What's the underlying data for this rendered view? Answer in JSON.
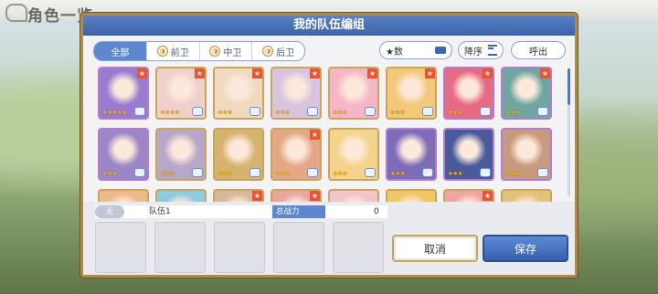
{
  "background": {
    "title": "角色一览"
  },
  "modal": {
    "title": "我的队伍编组"
  },
  "tabs": [
    {
      "label": "全部",
      "icon": ""
    },
    {
      "label": "前卫",
      "icon": "position-icon"
    },
    {
      "label": "中卫",
      "icon": "position-icon"
    },
    {
      "label": "后卫",
      "icon": "position-icon"
    }
  ],
  "sort": {
    "field": "★数",
    "order": "降序",
    "call": "呼出"
  },
  "characters": [
    {
      "stars": "★★★★★",
      "frame": "purple",
      "fav": true,
      "art": "#9a7bd0"
    },
    {
      "stars": "★★★★",
      "frame": "gold",
      "fav": true,
      "art": "#efd0cc"
    },
    {
      "stars": "★★★",
      "frame": "gold",
      "fav": true,
      "art": "#f1d9c0"
    },
    {
      "stars": "★★★",
      "frame": "gold",
      "fav": true,
      "art": "#d9c4dd"
    },
    {
      "stars": "★★★",
      "frame": "gold",
      "fav": true,
      "art": "#f5b7c8"
    },
    {
      "stars": "★★★",
      "frame": "gold",
      "fav": true,
      "art": "#f2c879"
    },
    {
      "stars": "★★★",
      "frame": "purple",
      "fav": true,
      "art": "#e76a84"
    },
    {
      "stars": "★★★",
      "frame": "purple",
      "fav": true,
      "art": "#6fa7a0"
    },
    {
      "stars": "★★★",
      "frame": "purple",
      "fav": false,
      "art": "#9b86c6"
    },
    {
      "stars": "★★★",
      "frame": "gold",
      "fav": false,
      "art": "#b7a7c8"
    },
    {
      "stars": "★★★",
      "frame": "gold",
      "fav": false,
      "art": "#d7b46d"
    },
    {
      "stars": "★★★",
      "frame": "gold",
      "fav": true,
      "art": "#e4a887"
    },
    {
      "stars": "★★★",
      "frame": "gold",
      "fav": false,
      "art": "#f3d48a"
    },
    {
      "stars": "★★★",
      "frame": "purple",
      "fav": false,
      "art": "#7d6cb8"
    },
    {
      "stars": "★★★",
      "frame": "purple",
      "fav": false,
      "art": "#4a5b9b"
    },
    {
      "stars": "★★★",
      "frame": "purple",
      "fav": false,
      "art": "#c79a7d"
    },
    {
      "stars": "",
      "frame": "gold",
      "fav": false,
      "art": "#f0b98a"
    },
    {
      "stars": "",
      "frame": "gold",
      "fav": false,
      "art": "#8ecbe0"
    },
    {
      "stars": "",
      "frame": "gold",
      "fav": true,
      "art": "#d6b89a"
    },
    {
      "stars": "",
      "frame": "gold",
      "fav": true,
      "art": "#e9a6a0"
    },
    {
      "stars": "",
      "frame": "gold",
      "fav": false,
      "art": "#f3c4c9"
    },
    {
      "stars": "",
      "frame": "gold",
      "fav": false,
      "art": "#f1c766"
    },
    {
      "stars": "",
      "frame": "gold",
      "fav": true,
      "art": "#f0a5a0"
    },
    {
      "stars": "",
      "frame": "gold",
      "fav": false,
      "art": "#e5c27a"
    }
  ],
  "party": {
    "badge": "无",
    "name": "队伍1",
    "power_label": "总战力",
    "power_value": "0"
  },
  "buttons": {
    "cancel": "取消",
    "save": "保存"
  }
}
